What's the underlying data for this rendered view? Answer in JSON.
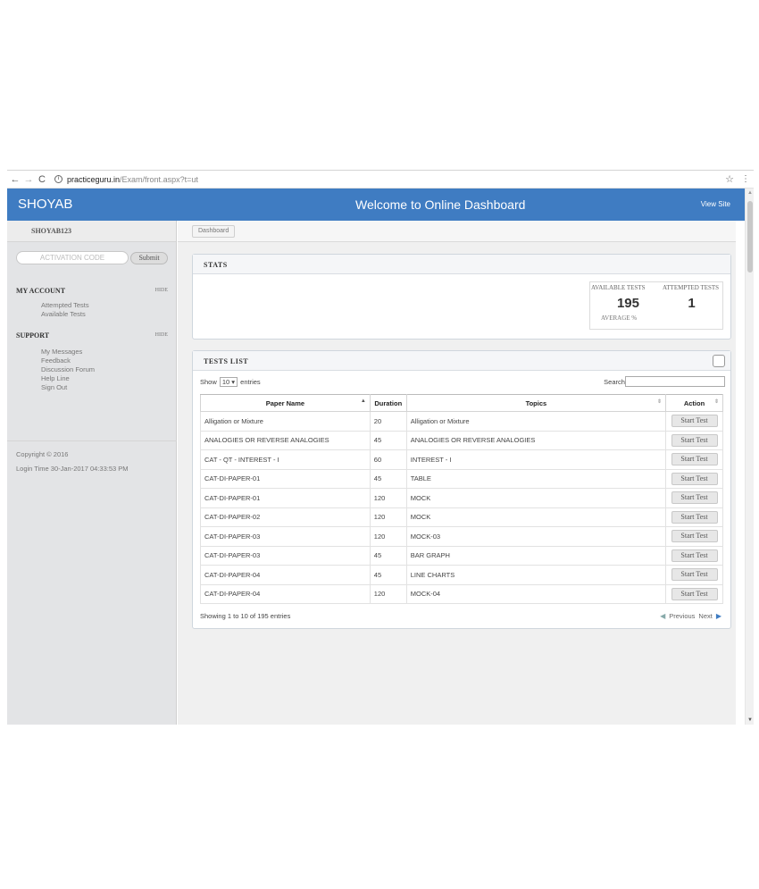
{
  "browser": {
    "url_domain": "practiceguru.in",
    "url_path": "/Exam/front.aspx?t=ut"
  },
  "topbar": {
    "brand": "SHOYAB",
    "welcome": "Welcome to Online Dashboard",
    "view_site": "View Site"
  },
  "sidebar": {
    "username": "SHOYAB123",
    "activation_placeholder": "ACTIVATION CODE",
    "submit_label": "Submit",
    "my_account": {
      "title": "MY ACCOUNT",
      "hide": "HIDE",
      "items": [
        "Attempted Tests",
        "Available Tests"
      ]
    },
    "support": {
      "title": "SUPPORT",
      "hide": "HIDE",
      "items": [
        "My Messages",
        "Feedback",
        "Discussion Forum",
        "Help Line",
        "Sign Out"
      ]
    },
    "copyright": "Copyright © 2016",
    "login_time": "Login Time 30-Jan-2017 04:33:53 PM"
  },
  "breadcrumb": {
    "label": "Dashboard"
  },
  "stats": {
    "title": "STATS",
    "available_label": "AVAILABLE TESTS",
    "attempted_label": "ATTEMPTED TESTS",
    "available_value": "195",
    "attempted_value": "1",
    "average_label": "AVERAGE %"
  },
  "tests": {
    "title": "TESTS LIST",
    "show_label": "Show",
    "entries_value": "10",
    "entries_label": "entries",
    "search_label": "Search:",
    "columns": {
      "paper": "Paper Name",
      "duration": "Duration",
      "topics": "Topics",
      "action": "Action"
    },
    "start_label": "Start Test",
    "rows": [
      {
        "paper": "Alligation or Mixture",
        "duration": "20",
        "topics": "Alligation or Mixture"
      },
      {
        "paper": "ANALOGIES OR REVERSE ANALOGIES",
        "duration": "45",
        "topics": "ANALOGIES OR REVERSE ANALOGIES"
      },
      {
        "paper": "CAT - QT - INTEREST - I",
        "duration": "60",
        "topics": "INTEREST - I"
      },
      {
        "paper": "CAT-DI-PAPER-01",
        "duration": "45",
        "topics": "TABLE"
      },
      {
        "paper": "CAT-DI-PAPER-01",
        "duration": "120",
        "topics": "MOCK"
      },
      {
        "paper": "CAT-DI-PAPER-02",
        "duration": "120",
        "topics": "MOCK"
      },
      {
        "paper": "CAT-DI-PAPER-03",
        "duration": "120",
        "topics": "MOCK-03"
      },
      {
        "paper": "CAT-DI-PAPER-03",
        "duration": "45",
        "topics": "BAR GRAPH"
      },
      {
        "paper": "CAT-DI-PAPER-04",
        "duration": "45",
        "topics": "LINE CHARTS"
      },
      {
        "paper": "CAT-DI-PAPER-04",
        "duration": "120",
        "topics": "MOCK-04"
      }
    ],
    "showing": "Showing 1 to 10 of 195 entries",
    "previous": "Previous",
    "next": "Next"
  }
}
